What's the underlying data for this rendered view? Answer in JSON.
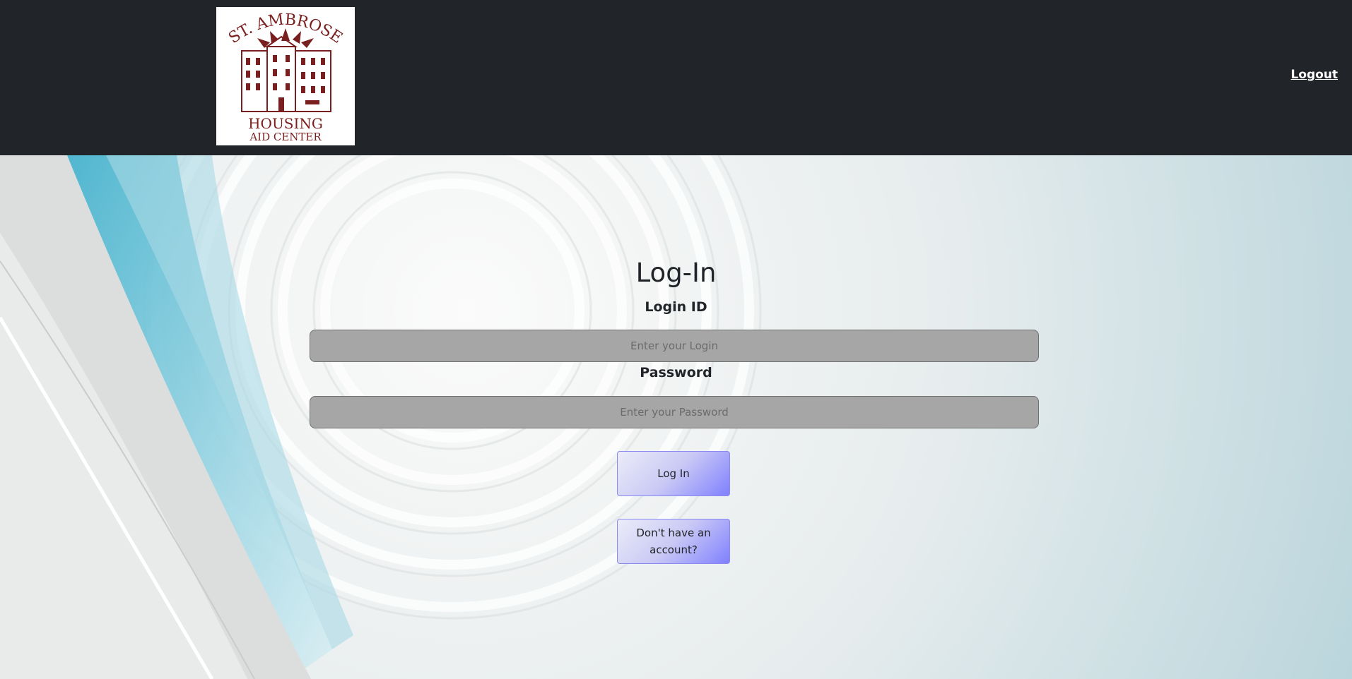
{
  "header": {
    "logo": {
      "line1": "ST. AMBROSE",
      "line2": "HOUSING",
      "line3": "AID CENTER",
      "color": "#7a1f1f"
    },
    "logout_label": "Logout"
  },
  "form": {
    "title": "Log-In",
    "login_label": "Login ID",
    "login_placeholder": "Enter your Login",
    "password_label": "Password",
    "password_placeholder": "Enter your Password",
    "login_button": "Log In",
    "signup_button": "Don't have an account?"
  },
  "colors": {
    "header_bg": "#212529",
    "button_accent": "#8080ff",
    "input_bg": "#a6a6a6"
  }
}
